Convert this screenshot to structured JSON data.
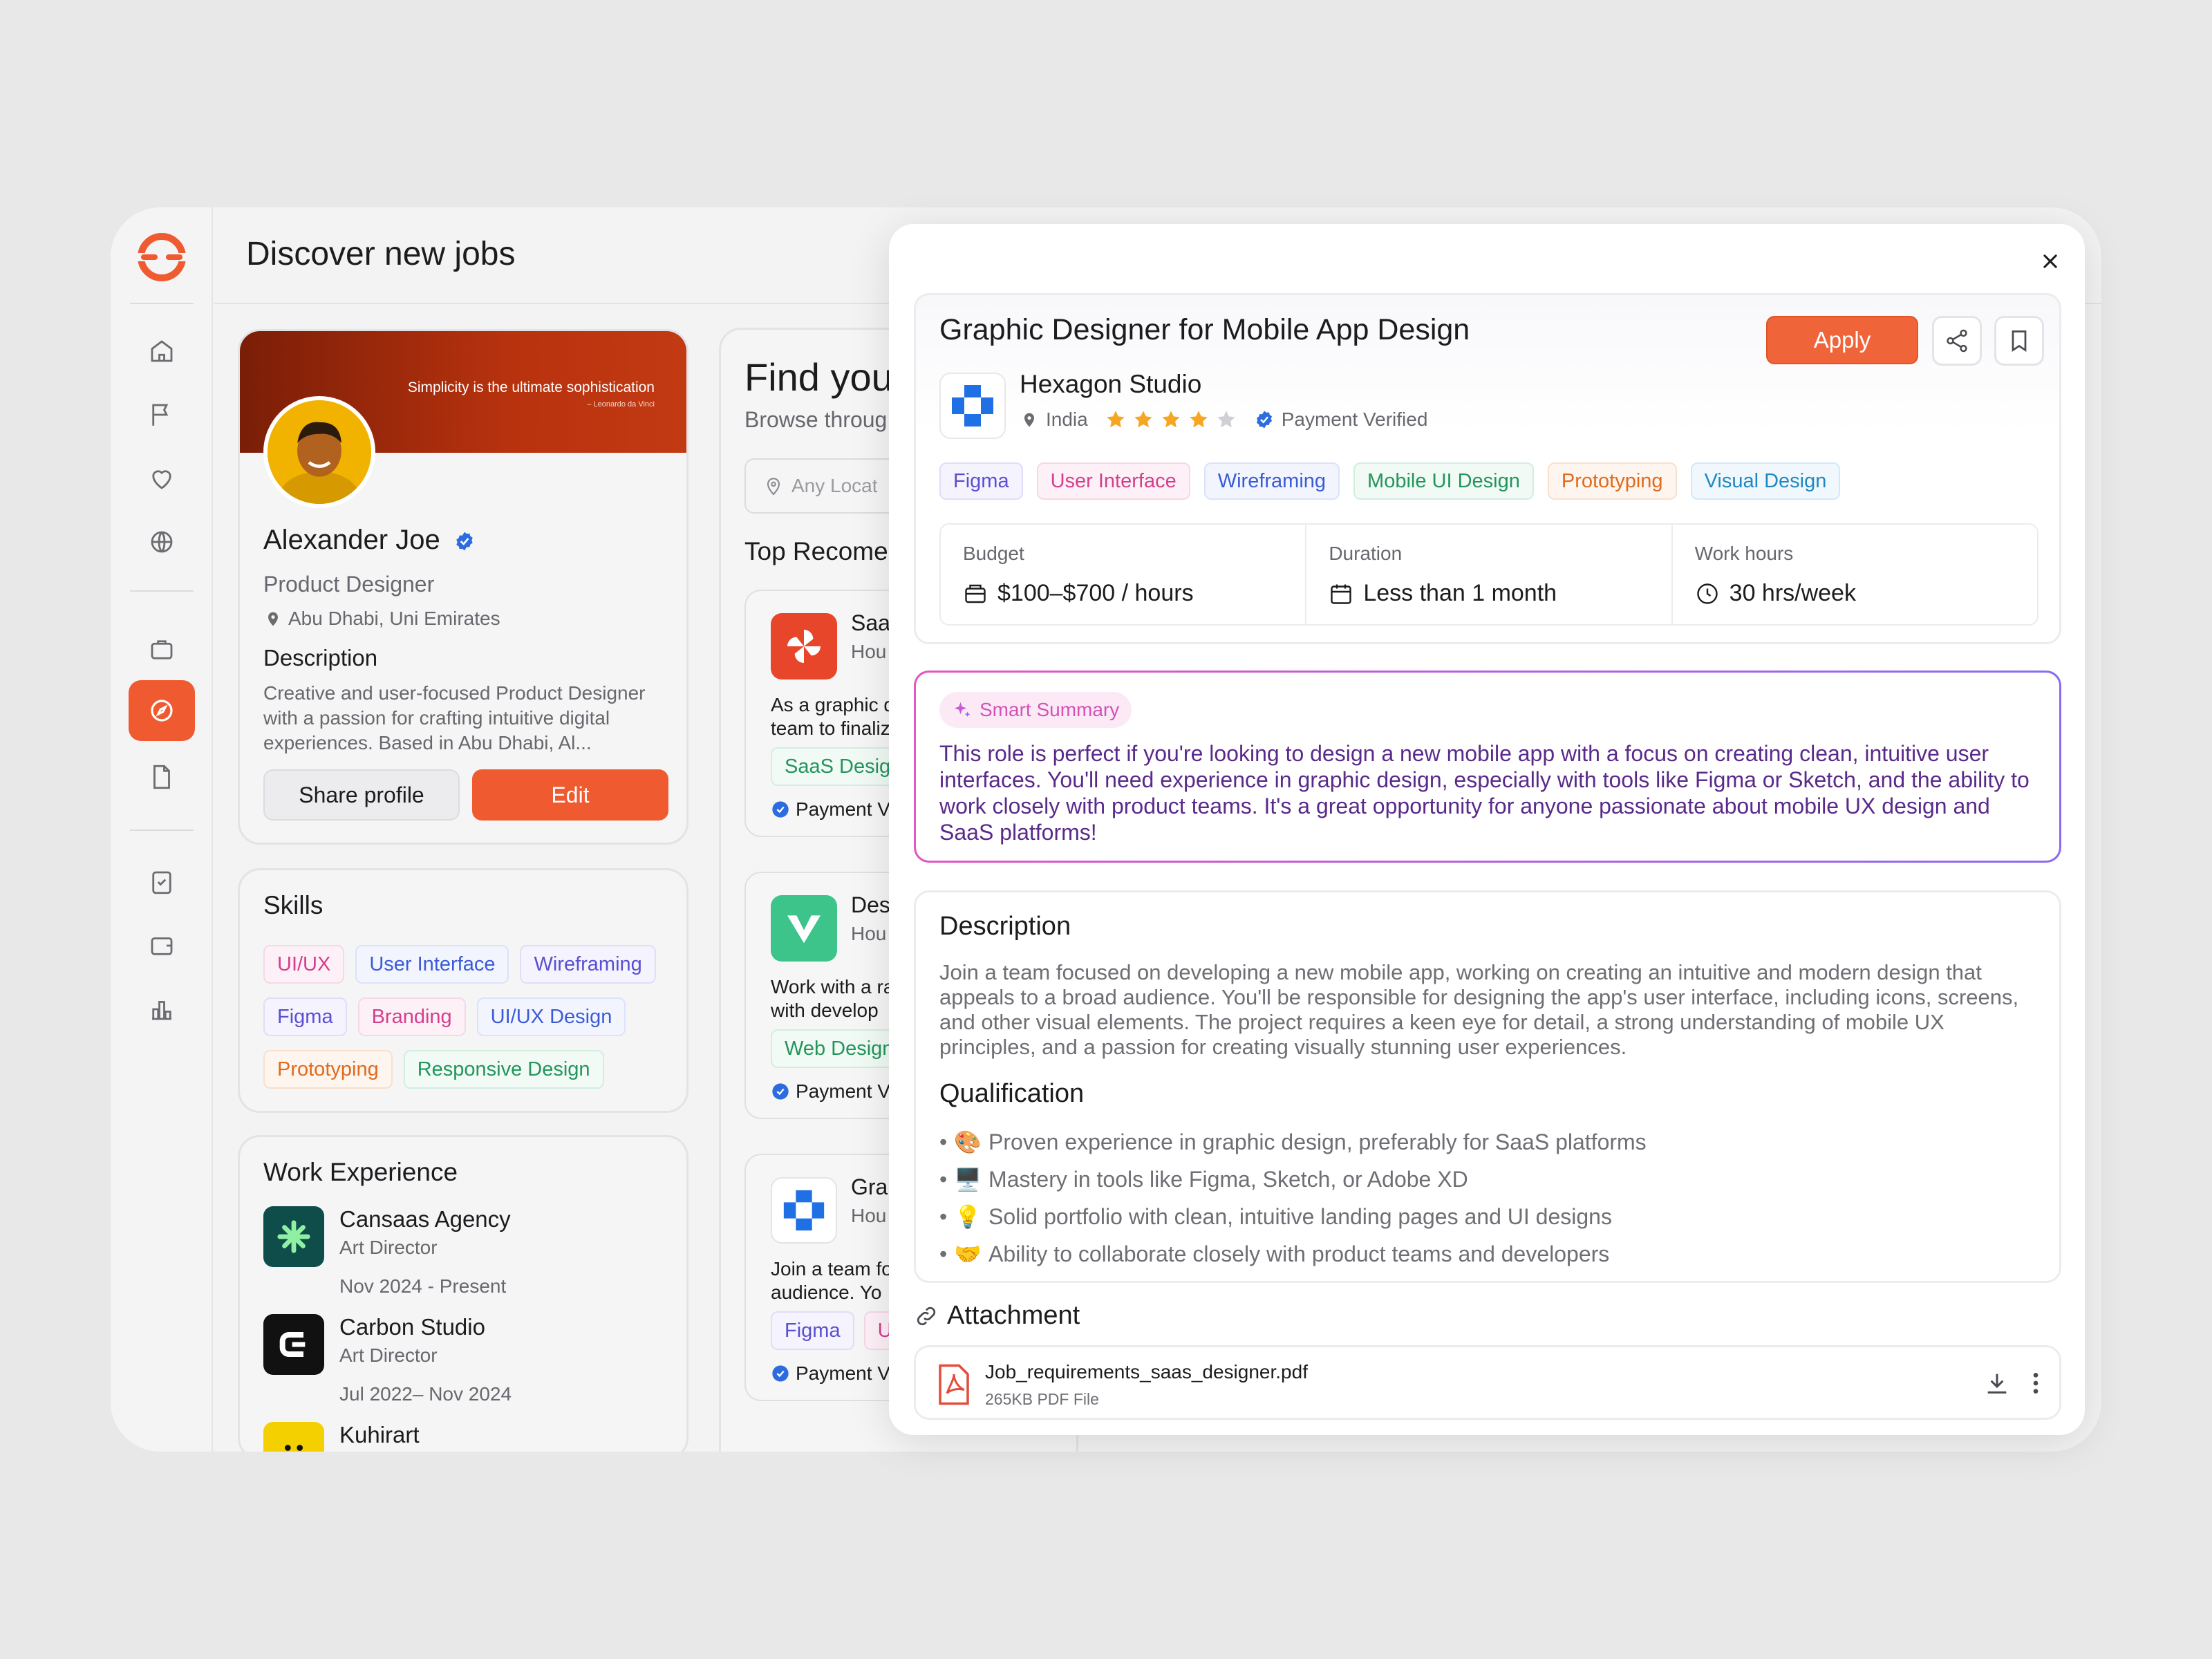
{
  "page": {
    "title": "Discover new jobs"
  },
  "profile": {
    "quote": "Simplicity is the ultimate sophistication",
    "quote_author": "– Leonardo da Vinci",
    "name": "Alexander Joe",
    "role": "Product Designer",
    "location": "Abu Dhabi, Uni Emirates",
    "desc_heading": "Description",
    "description": "Creative and user-focused Product Designer with a passion for crafting intuitive digital experiences. Based in Abu Dhabi, Al...",
    "share_label": "Share profile",
    "edit_label": "Edit"
  },
  "skills": {
    "heading": "Skills",
    "items": [
      "UI/UX",
      "User Interface",
      "Wireframing",
      "Figma",
      "Branding",
      "UI/UX Design",
      "Prototyping",
      "Responsive Design"
    ]
  },
  "experience": {
    "heading": "Work Experience",
    "items": [
      {
        "company": "Cansaas Agency",
        "role": "Art Director",
        "dates": "Nov 2024 - Present"
      },
      {
        "company": "Carbon Studio",
        "role": "Art Director",
        "dates": "Jul 2022– Nov 2024"
      },
      {
        "company": "Kuhirart"
      }
    ]
  },
  "find": {
    "title": "Find you",
    "subtitle": "Browse throug",
    "location_placeholder": "Any Locat",
    "top_heading": "Top Recome",
    "jobs": [
      {
        "title": "Saa",
        "meta": "Hou",
        "excerpt1": "As a graphic d",
        "excerpt2": "team to finaliz",
        "tag": "SaaS Desig",
        "verified": "Payment V"
      },
      {
        "title": "Des",
        "meta": "Hou",
        "excerpt1": "Work with a ra",
        "excerpt2": "with develop",
        "tag": "Web Design",
        "verified": "Payment V"
      },
      {
        "title": "Gra",
        "meta": "Hou",
        "excerpt1": "Join a team fo",
        "excerpt2": "audience. Yo",
        "tag": "Figma",
        "tag2": "U",
        "verified": "Payment V"
      }
    ]
  },
  "job": {
    "title": "Graphic Designer for Mobile App Design",
    "apply_label": "Apply",
    "company": "Hexagon Studio",
    "country": "India",
    "rating": 4,
    "rating_max": 5,
    "payment": "Payment Verified",
    "tags": [
      "Figma",
      "User Interface",
      "Wireframing",
      "Mobile UI Design",
      "Prototyping",
      "Visual Design"
    ],
    "budget_label": "Budget",
    "budget_value": "$100–$700 / hours",
    "duration_label": "Duration",
    "duration_value": "Less than 1 month",
    "hours_label": "Work hours",
    "hours_value": "30 hrs/week",
    "smart_label": "Smart Summary",
    "smart_text": "This role is perfect if you're looking to design a new mobile app with a focus on creating clean, intuitive user interfaces. You'll need experience in graphic design, especially with tools like Figma or Sketch, and the ability to work closely with product teams. It's a great opportunity for anyone passionate about mobile UX design and SaaS platforms!",
    "desc_heading": "Description",
    "description": "Join a team focused on developing a new mobile app, working on creating an intuitive and modern design that appeals to a broad audience. You'll be responsible for designing the app's user interface, including icons, screens, and other visual elements. The project requires a keen eye for detail, a strong understanding of mobile UX principles, and a passion for creating visually stunning user experiences.",
    "qual_heading": "Qualification",
    "qualifications": [
      {
        "emoji": "🎨",
        "text": "Proven experience in graphic design, preferably for SaaS platforms"
      },
      {
        "emoji": "🖥️",
        "text": "Mastery in tools like Figma, Sketch, or Adobe XD"
      },
      {
        "emoji": "💡",
        "text": "Solid portfolio with clean, intuitive landing pages and UI designs"
      },
      {
        "emoji": "🤝",
        "text": "Ability to collaborate closely with product teams and developers"
      }
    ],
    "attachment_heading": "Attachment",
    "file_name": "Job_requirements_saas_designer.pdf",
    "file_size": "265KB PDF File"
  },
  "colors": {
    "accent": "#ef5a30",
    "verified": "#2d6cdf",
    "star": "#f5a623"
  }
}
